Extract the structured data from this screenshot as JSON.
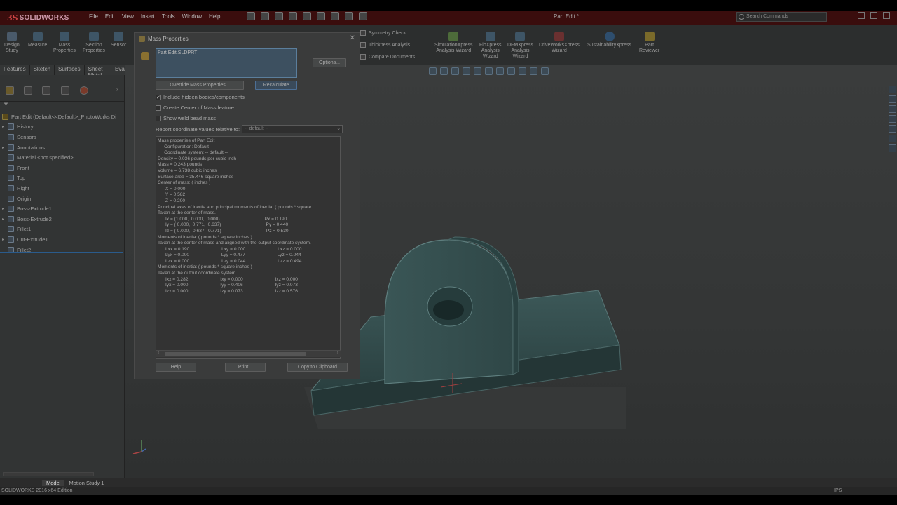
{
  "app": {
    "logo_ds": "3S",
    "logo_text": "SOLIDWORKS",
    "doc_title": "Part Edit *",
    "search_placeholder": "Search Commands"
  },
  "menu": [
    "File",
    "Edit",
    "View",
    "Insert",
    "Tools",
    "Window",
    "Help"
  ],
  "ribbon": {
    "left_buttons": [
      {
        "label": "Design\nStudy",
        "icon": "design-study-icon"
      },
      {
        "label": "Measure",
        "icon": "measure-icon"
      },
      {
        "label": "Mass\nProperties",
        "icon": "mass-properties-icon"
      },
      {
        "label": "Section\nProperties",
        "icon": "section-properties-icon"
      },
      {
        "label": "Sensor",
        "icon": "sensor-icon"
      }
    ],
    "small_items": [
      "Symmetry Check",
      "Thickness Analysis",
      "Compare Documents"
    ],
    "right_buttons": [
      {
        "label": "SimulationXpress\nAnalysis Wizard",
        "icon": "simulationxpress-icon"
      },
      {
        "label": "FloXpress\nAnalysis\nWizard",
        "icon": "floxpress-icon"
      },
      {
        "label": "DFMXpress\nAnalysis\nWizard",
        "icon": "dfmxpress-icon"
      },
      {
        "label": "DriveWorksXpress\nWizard",
        "icon": "driveworksxpress-icon"
      },
      {
        "label": "SustainabilityXpress",
        "icon": "sustainabilityxpress-icon"
      },
      {
        "label": "Part\nReviewer",
        "icon": "part-reviewer-icon"
      }
    ]
  },
  "tabs": [
    "Features",
    "Sketch",
    "Surfaces",
    "Sheet Metal",
    "Evalu"
  ],
  "tree": [
    {
      "label": "Part Edit  (Default<<Default>_PhotoWorks Di",
      "expand": ""
    },
    {
      "label": "History",
      "expand": "▸"
    },
    {
      "label": "Sensors",
      "expand": ""
    },
    {
      "label": "Annotations",
      "expand": "▸"
    },
    {
      "label": "Material <not specified>",
      "expand": ""
    },
    {
      "label": "Front",
      "expand": ""
    },
    {
      "label": "Top",
      "expand": ""
    },
    {
      "label": "Right",
      "expand": ""
    },
    {
      "label": "Origin",
      "expand": ""
    },
    {
      "label": "Boss-Extrude1",
      "expand": "▸"
    },
    {
      "label": "Boss-Extrude2",
      "expand": "▸"
    },
    {
      "label": "Fillet1",
      "expand": ""
    },
    {
      "label": "Cut-Extrude1",
      "expand": "▸"
    },
    {
      "label": "Fillet2",
      "expand": ""
    }
  ],
  "bottom_tabs": [
    "Model",
    "Motion Study 1"
  ],
  "status": {
    "left": "SOLIDWORKS 2016 x64 Edition",
    "right": "IPS"
  },
  "dialog": {
    "title": "Mass Properties",
    "selection": "Part Edit.SLDPRT",
    "options_label": "Options...",
    "override_label": "Override Mass Properties...",
    "recalculate_label": "Recalculate",
    "checkboxes": [
      {
        "label": "Include hidden bodies/components",
        "checked": true
      },
      {
        "label": "Create Center of Mass feature",
        "checked": false
      },
      {
        "label": "Show weld bead mass",
        "checked": false
      }
    ],
    "coord_label": "Report coordinate values relative to:",
    "coord_value": "-- default --",
    "results": [
      "Mass properties of Part Edit",
      "     Configuration: Default",
      "     Coordinate system: -- default --",
      "",
      "Density = 0.036 pounds per cubic inch",
      "",
      "Mass = 0.243 pounds",
      "",
      "Volume = 6.738 cubic inches",
      "",
      "Surface area = 35.446 square inches",
      "",
      "Center of mass: ( inches )",
      "      X = 0.000",
      "      Y = 0.582",
      "      Z = 0.200",
      "",
      "Principal axes of inertia and principal moments of inertia: ( pounds * square",
      "Taken at the center of mass.",
      "      Ix = (1.000,  0.000,  0.000)                                   Px = 0.190",
      "      Iy = ( 0.000,  0.771,  0.637)                                   Py = 0.440",
      "      Iz = ( 0.000, -0.637,  0.771)                                   Pz = 0.530",
      "",
      "Moments of inertia: ( pounds * square inches )",
      "Taken at the center of mass and aligned with the output coordinate system.",
      "      Lxx = 0.190                         Lxy = 0.000                         Lxz = 0.000",
      "      Lyx = 0.000                         Lyy = 0.477                         Lyz = 0.044",
      "      Lzx = 0.000                         Lzy = 0.044                         Lzz = 0.494",
      "",
      "Moments of inertia: ( pounds * square inches )",
      "Taken at the output coordinate system.",
      "      Ixx = 0.282                         Ixy = 0.000                         Ixz = 0.000",
      "      Iyx = 0.000                         Iyy = 0.406                         Iyz = 0.073",
      "      Izx = 0.000                         Izy = 0.073                         Izz = 0.576"
    ],
    "help_label": "Help",
    "print_label": "Print...",
    "copy_label": "Copy to Clipboard"
  }
}
